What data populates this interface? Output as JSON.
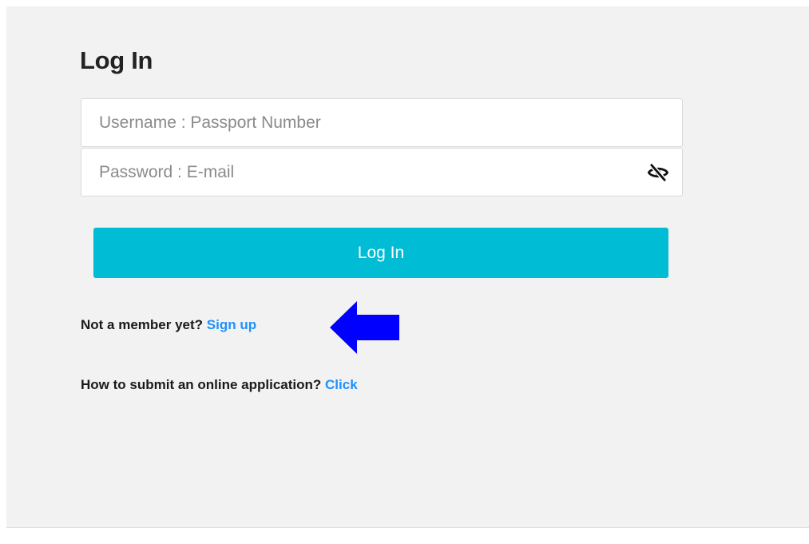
{
  "colors": {
    "accent": "#00bcd4",
    "link": "#1e90ff",
    "arrow": "#0000ff",
    "panel_background": "#f2f2f2"
  },
  "login": {
    "title": "Log In",
    "username_placeholder": "Username : Passport Number",
    "password_placeholder": "Password : E-mail",
    "password_toggle_icon": "eye-slash-icon",
    "submit_label": "Log In"
  },
  "signup": {
    "prompt": "Not a member yet?",
    "link_label": "Sign up",
    "annotation_icon": "arrow-left-icon"
  },
  "help": {
    "prompt": "How to submit an online application?",
    "link_label": "Click"
  }
}
